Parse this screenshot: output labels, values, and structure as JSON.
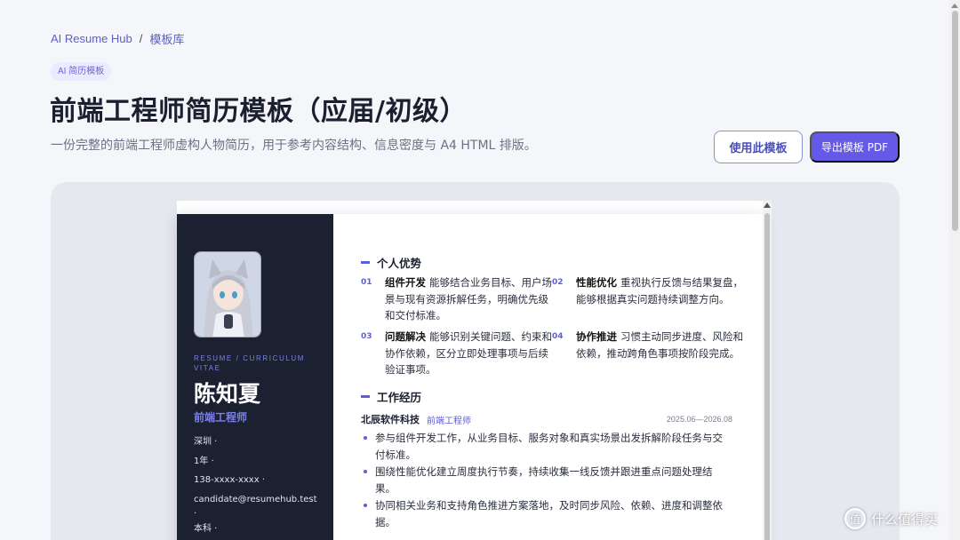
{
  "breadcrumb": {
    "root": "AI Resume Hub",
    "sep": "/",
    "current": "模板库"
  },
  "tag": "AI 简历模板",
  "title": "前端工程师简历模板（应届/初级）",
  "subtitle": "一份完整的前端工程师虚构人物简历，用于参考内容结构、信息密度与 A4 HTML 排版。",
  "actions": {
    "use_template": "使用此模板",
    "export_pdf": "导出模板 PDF"
  },
  "resume": {
    "tag_label": "RESUME / CURRICULUM VITAE",
    "name": "陈知夏",
    "role": "前端工程师",
    "contacts": [
      "深圳 ·",
      "1年 ·",
      "138-xxxx-xxxx ·",
      "candidate@resumehub.test",
      "·",
      "本科 ·"
    ],
    "strengths_title": "个人优势",
    "strengths": [
      {
        "num": "01",
        "title": "组件开发",
        "text": "能够结合业务目标、用户场景与现有资源拆解任务，明确优先级和交付标准。"
      },
      {
        "num": "02",
        "title": "性能优化",
        "text": "重视执行反馈与结果复盘，能够根据真实问题持续调整方向。"
      },
      {
        "num": "03",
        "title": "问题解决",
        "text": "能够识别关键问题、约束和协作依赖，区分立即处理事项与后续验证事项。"
      },
      {
        "num": "04",
        "title": "协作推进",
        "text": "习惯主动同步进度、风险和依赖，推动跨角色事项按阶段完成。"
      }
    ],
    "work_title": "工作经历",
    "job": {
      "company": "北辰软件科技",
      "role": "前端工程师",
      "date": "2025.06—2026.08",
      "bullets": [
        "参与组件开发工作，从业务目标、服务对象和真实场景出发拆解阶段任务与交付标准。",
        "围绕性能优化建立周度执行节奏，持续收集一线反馈并跟进重点问题处理结果。",
        "协同相关业务和支持角色推进方案落地，及时同步风险、依赖、进度和调整依据。"
      ]
    }
  },
  "watermark": {
    "icon": "值",
    "text": "什么值得买"
  },
  "colors": {
    "accent": "#6559e8",
    "sidebar": "#1b2131",
    "page_bg": "#f5f6fa"
  }
}
